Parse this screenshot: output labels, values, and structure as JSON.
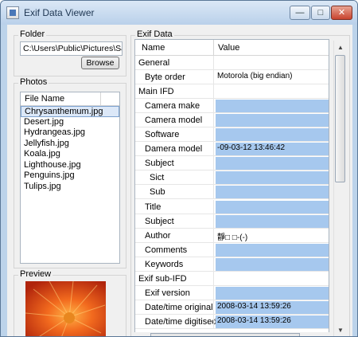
{
  "window": {
    "title": "Exif Data Viewer",
    "minimize": "—",
    "maximize": "□",
    "close": "✕"
  },
  "folder": {
    "label": "Folder",
    "path": "C:\\Users\\Public\\Pictures\\Sampl",
    "browse": "Browse"
  },
  "photos": {
    "label": "Photos",
    "column": "File Name",
    "files": [
      "Chrysanthemum.jpg",
      "Desert.jpg",
      "Hydrangeas.jpg",
      "Jellyfish.jpg",
      "Koala.jpg",
      "Lighthouse.jpg",
      "Penguins.jpg",
      "Tulips.jpg"
    ],
    "selected_index": 0
  },
  "preview": {
    "label": "Preview"
  },
  "exif": {
    "label": "Exif Data",
    "col_name": "Name",
    "col_value": "Value",
    "rows": [
      {
        "name": "General",
        "value": "",
        "indent": 0,
        "hl": false
      },
      {
        "name": "Byte order",
        "value": "Motorola (big endian)",
        "indent": 1,
        "hl": false
      },
      {
        "name": "Main IFD",
        "value": "",
        "indent": 0,
        "hl": false
      },
      {
        "name": "Camera make",
        "value": "",
        "indent": 1,
        "hl": true
      },
      {
        "name": "Camera model",
        "value": "",
        "indent": 1,
        "hl": true
      },
      {
        "name": "Software",
        "value": "",
        "indent": 1,
        "hl": true
      },
      {
        "name": "Damera model",
        "value": "-09-03-12 13:46:42",
        "indent": 1,
        "hl": true
      },
      {
        "name": "Subject",
        "value": "",
        "indent": 1,
        "hl": true
      },
      {
        "name": "Sict",
        "value": "",
        "indent": 2,
        "hl": true
      },
      {
        "name": "Sub",
        "value": "",
        "indent": 2,
        "hl": true
      },
      {
        "name": "Title",
        "value": "",
        "indent": 1,
        "hl": true
      },
      {
        "name": "Subject",
        "value": "",
        "indent": 1,
        "hl": true
      },
      {
        "name": "Author",
        "value": "靜□ □-(-)",
        "indent": 1,
        "hl": false
      },
      {
        "name": "Comments",
        "value": "",
        "indent": 1,
        "hl": true
      },
      {
        "name": "Keywords",
        "value": "",
        "indent": 1,
        "hl": true
      },
      {
        "name": "Exif sub-IFD",
        "value": "",
        "indent": 0,
        "hl": false
      },
      {
        "name": "Exif version",
        "value": "",
        "indent": 1,
        "hl": true
      },
      {
        "name": "Date/time original",
        "value": "2008-03-14 13:59:26",
        "indent": 1,
        "hl": true
      },
      {
        "name": "Date/time digitised",
        "value": "2008-03-14 13:59:26",
        "indent": 1,
        "hl": true
      }
    ]
  },
  "colors": {
    "selection": "#a6c8ee",
    "titlebar": "#bcd3ea"
  },
  "icons": {
    "scroll_up": "▲",
    "scroll_down": "▼",
    "scroll_left": "◄",
    "scroll_right": "►"
  }
}
